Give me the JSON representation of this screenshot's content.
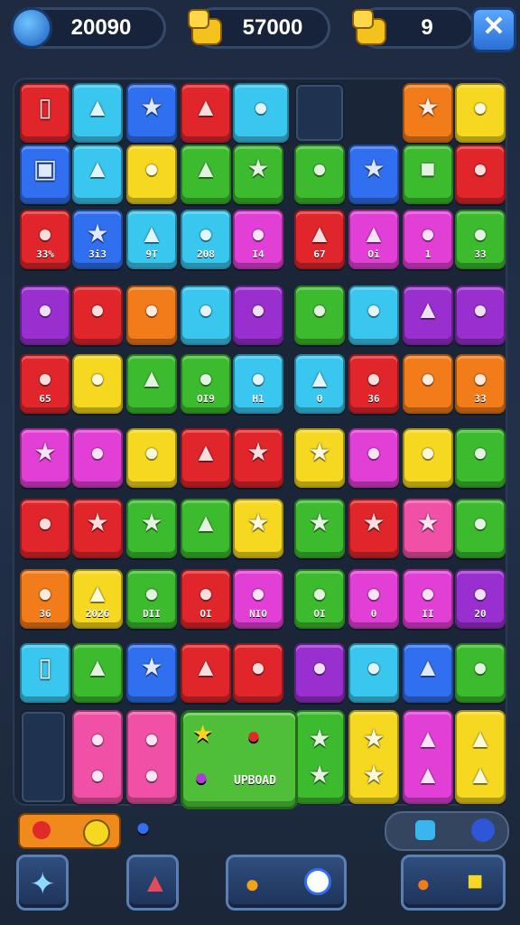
{
  "hud": {
    "score": "20090",
    "coins": "57000",
    "moves": "9",
    "left_icon": "dial-icon",
    "coin_icon": "coin-stack-icon",
    "moves_icon": "coin-stack-icon",
    "close_icon": "close-icon"
  },
  "colors": {
    "red": "#e0262b",
    "cyan": "#39c6ef",
    "blue": "#2f6ff0",
    "purple": "#9a2fcf",
    "magenta": "#e23fd6",
    "green": "#3dbb2f",
    "yellow": "#f5d81f",
    "orange": "#f27b1a",
    "pink": "#f050a6"
  },
  "board": {
    "rows": [
      [
        {
          "c": "red",
          "g": "▯"
        },
        {
          "c": "cyan",
          "g": "▲"
        },
        {
          "c": "blue",
          "g": "★"
        },
        {
          "c": "red",
          "g": "▲"
        },
        {
          "c": "cyan",
          "g": "●"
        },
        {
          "c": "empty",
          "g": ""
        },
        {
          "c": "orange",
          "g": "★"
        },
        {
          "c": "yellow",
          "g": "●"
        }
      ],
      [
        {
          "c": "blue",
          "g": "▣"
        },
        {
          "c": "cyan",
          "g": "▲"
        },
        {
          "c": "yellow",
          "g": "●"
        },
        {
          "c": "green",
          "g": "▲"
        },
        {
          "c": "green",
          "g": "★"
        },
        {
          "c": "green",
          "g": "●"
        },
        {
          "c": "blue",
          "g": "★"
        },
        {
          "c": "green",
          "g": "■"
        },
        {
          "c": "red",
          "g": "●"
        }
      ],
      [
        {
          "c": "red",
          "g": "●",
          "t": "33%"
        },
        {
          "c": "blue",
          "g": "★",
          "t": "3i3"
        },
        {
          "c": "cyan",
          "g": "▲",
          "t": "9T"
        },
        {
          "c": "cyan",
          "g": "●",
          "t": "208"
        },
        {
          "c": "magenta",
          "g": "●",
          "t": "I4"
        },
        {
          "c": "red",
          "g": "▲",
          "t": "67"
        },
        {
          "c": "magenta",
          "g": "▲",
          "t": "Oi"
        },
        {
          "c": "magenta",
          "g": "●",
          "t": "1"
        },
        {
          "c": "green",
          "g": "●",
          "t": "33"
        }
      ],
      [
        {
          "c": "purple",
          "g": "●"
        },
        {
          "c": "red",
          "g": "●"
        },
        {
          "c": "orange",
          "g": "●"
        },
        {
          "c": "cyan",
          "g": "●"
        },
        {
          "c": "purple",
          "g": "●"
        },
        {
          "c": "green",
          "g": "●"
        },
        {
          "c": "cyan",
          "g": "●"
        },
        {
          "c": "purple",
          "g": "▲"
        },
        {
          "c": "purple",
          "g": "●"
        }
      ],
      [
        {
          "c": "red",
          "g": "●",
          "t": "65"
        },
        {
          "c": "yellow",
          "g": "●"
        },
        {
          "c": "green",
          "g": "▲"
        },
        {
          "c": "green",
          "g": "●",
          "t": "OI9"
        },
        {
          "c": "cyan",
          "g": "●",
          "t": "H1"
        },
        {
          "c": "cyan",
          "g": "▲",
          "t": "0"
        },
        {
          "c": "red",
          "g": "●",
          "t": "36"
        },
        {
          "c": "orange",
          "g": "●"
        },
        {
          "c": "orange",
          "g": "●",
          "t": "33"
        }
      ],
      [
        {
          "c": "magenta",
          "g": "★"
        },
        {
          "c": "magenta",
          "g": "●"
        },
        {
          "c": "yellow",
          "g": "●"
        },
        {
          "c": "red",
          "g": "▲"
        },
        {
          "c": "red",
          "g": "★"
        },
        {
          "c": "yellow",
          "g": "★"
        },
        {
          "c": "magenta",
          "g": "●"
        },
        {
          "c": "yellow",
          "g": "●"
        },
        {
          "c": "green",
          "g": "●"
        }
      ],
      [
        {
          "c": "red",
          "g": "●"
        },
        {
          "c": "red",
          "g": "★"
        },
        {
          "c": "green",
          "g": "★"
        },
        {
          "c": "green",
          "g": "▲"
        },
        {
          "c": "yellow",
          "g": "★"
        },
        {
          "c": "green",
          "g": "★"
        },
        {
          "c": "red",
          "g": "★"
        },
        {
          "c": "pink",
          "g": "★"
        },
        {
          "c": "green",
          "g": "●"
        }
      ],
      [
        {
          "c": "orange",
          "g": "●",
          "t": "36"
        },
        {
          "c": "yellow",
          "g": "▲",
          "t": "2026"
        },
        {
          "c": "green",
          "g": "●",
          "t": "DII"
        },
        {
          "c": "red",
          "g": "●",
          "t": "OI"
        },
        {
          "c": "magenta",
          "g": "●",
          "t": "NIO"
        },
        {
          "c": "green",
          "g": "●",
          "t": "OI"
        },
        {
          "c": "magenta",
          "g": "●",
          "t": "0"
        },
        {
          "c": "magenta",
          "g": "●",
          "t": "II"
        },
        {
          "c": "purple",
          "g": "●",
          "t": "20"
        }
      ],
      [
        {
          "c": "cyan",
          "g": "▯"
        },
        {
          "c": "green",
          "g": "▲"
        },
        {
          "c": "blue",
          "g": "★"
        },
        {
          "c": "red",
          "g": "▲"
        },
        {
          "c": "red",
          "g": "●"
        },
        {
          "c": "purple",
          "g": "●"
        },
        {
          "c": "cyan",
          "g": "●"
        },
        {
          "c": "blue",
          "g": "▲"
        },
        {
          "c": "green",
          "g": "●"
        }
      ]
    ],
    "bottom_row": [
      {
        "c": "red",
        "g": "●"
      },
      {
        "c": "pink",
        "g": "●"
      },
      {
        "c": "green",
        "g": "★"
      },
      {
        "c": "yellow",
        "g": "★"
      },
      {
        "c": "magenta",
        "g": "▲"
      },
      {
        "c": "yellow",
        "g": "▲"
      }
    ],
    "big_tile_label": "UPBOAD"
  },
  "footer": {
    "left_slider": "toggle-switch",
    "center_icon": "berry-icon",
    "right_pill": "status-pill",
    "buttons": [
      "star-icon",
      "potion-icon",
      "boost-icon",
      "reward-icon"
    ]
  }
}
